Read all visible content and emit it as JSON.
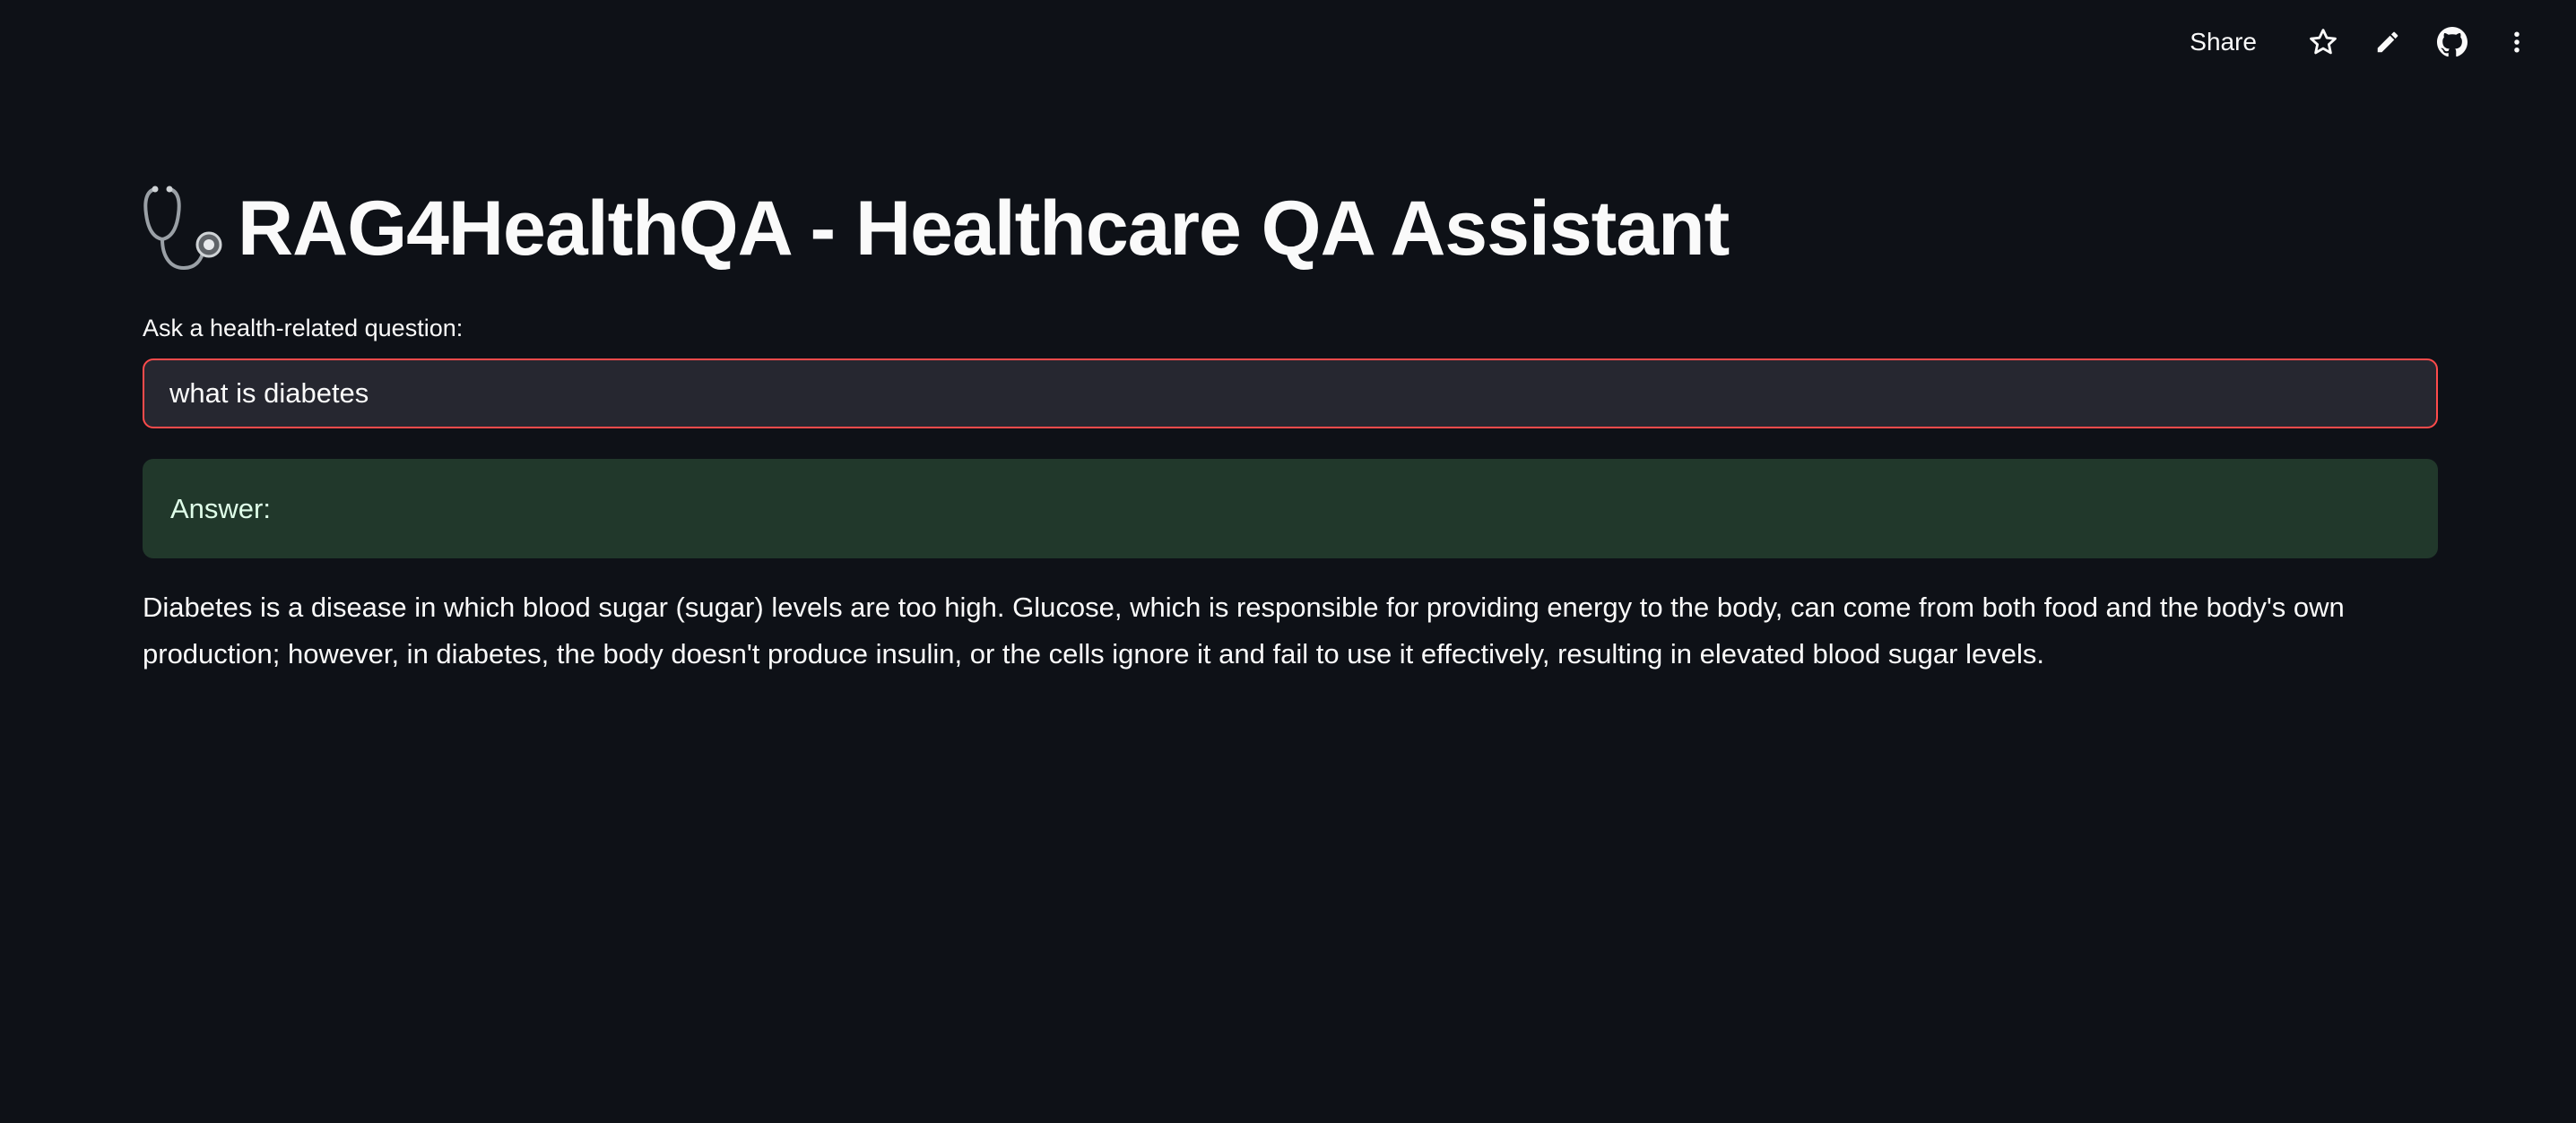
{
  "toolbar": {
    "share_label": "Share",
    "icons": [
      "star-icon",
      "pencil-icon",
      "github-icon",
      "more-vert-icon"
    ]
  },
  "header": {
    "title_icon": "stethoscope-icon",
    "title": "RAG4HealthQA - Healthcare QA Assistant"
  },
  "question": {
    "label": "Ask a health-related question:",
    "value": "what is diabetes"
  },
  "answer": {
    "heading": "Answer:",
    "text": "Diabetes is a disease in which blood sugar (sugar) levels are too high. Glucose, which is responsible for providing energy to the body, can come from both food and the body's own production; however, in diabetes, the body doesn't produce insulin, or the cells ignore it and fail to use it effectively, resulting in elevated blood sugar levels."
  },
  "colors": {
    "background": "#0e1117",
    "input_border_focus": "#ff4b4b",
    "input_background": "#262730",
    "success_background": "#21382b",
    "text": "#fafafa"
  }
}
